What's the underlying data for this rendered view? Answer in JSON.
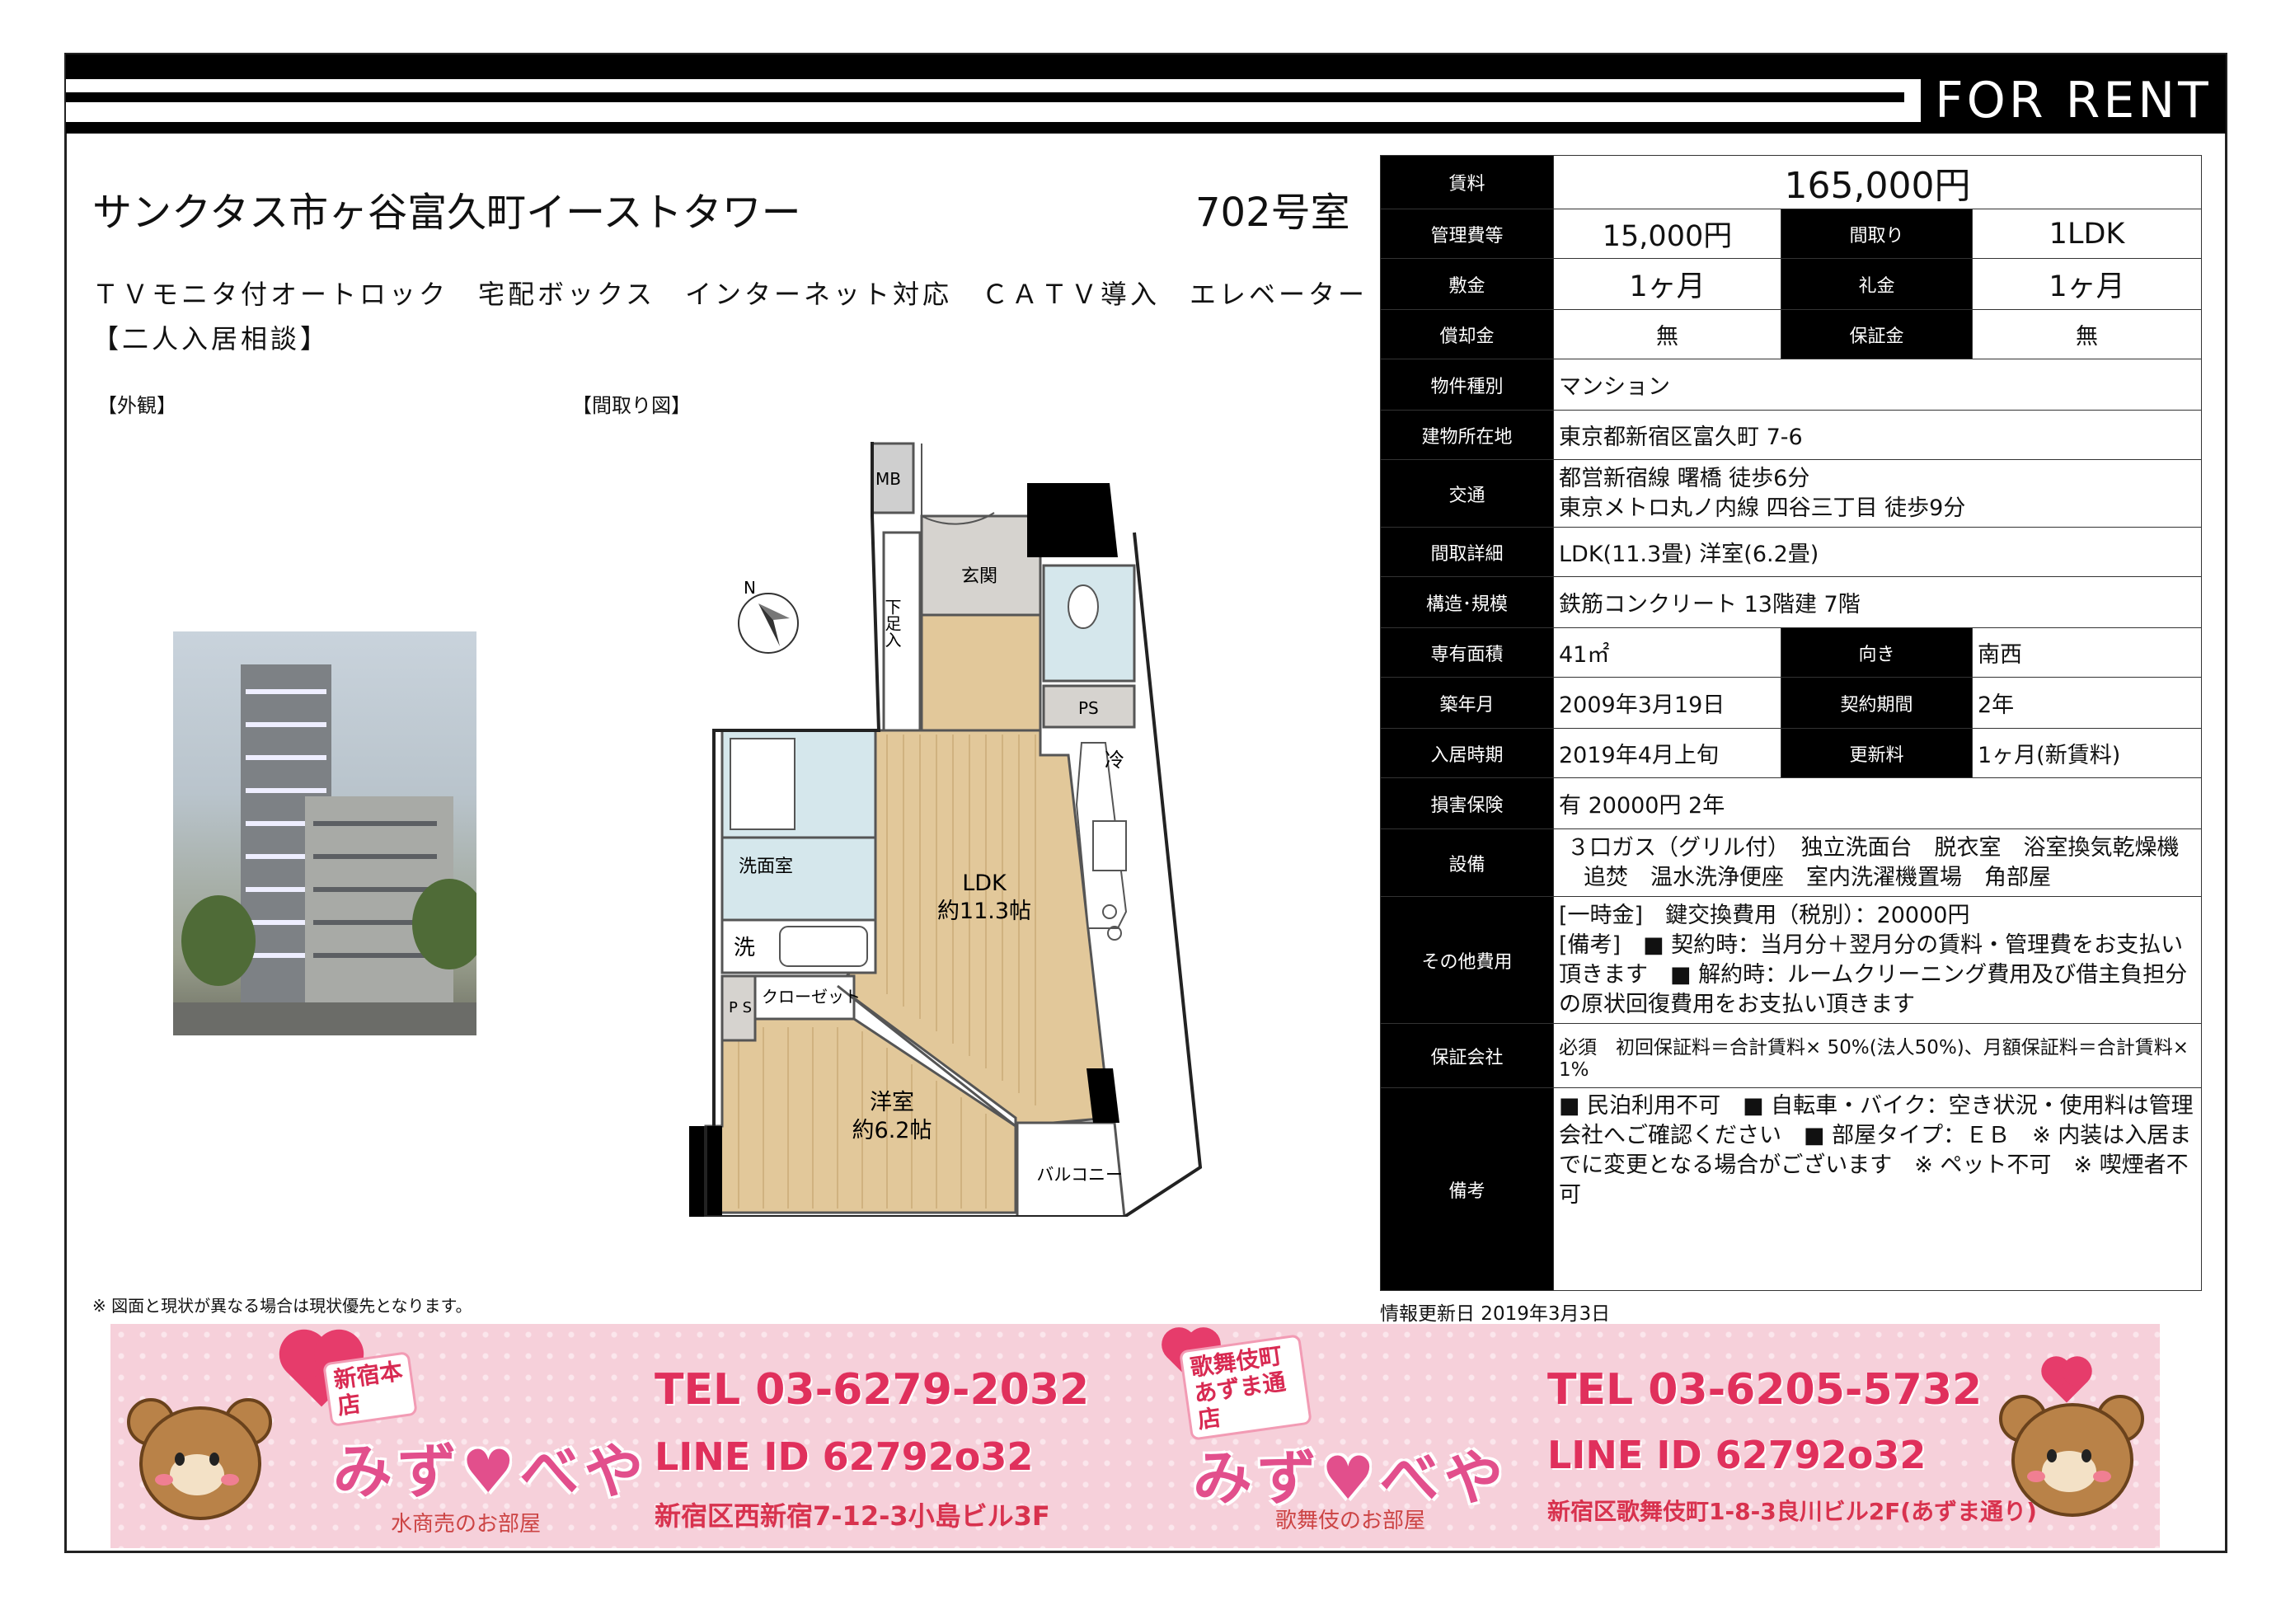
{
  "header": {
    "label": "FOR RENT"
  },
  "property": {
    "name": "サンクタス市ヶ谷富久町イーストタワー",
    "room": "702号室",
    "features_line1": "ＴＶモニタ付オートロック　宅配ボックス　インターネット対応　ＣＡＴＶ導入　エレベーター",
    "features_line2": "【二人入居相談】"
  },
  "sections": {
    "exterior": "【外観】",
    "floorplan": "【間取り図】"
  },
  "floorplan": {
    "compass": "N",
    "rooms": {
      "mb": "MB",
      "genkan": "玄関",
      "shoes": "下足入",
      "ps1": "PS",
      "fridge": "冷",
      "washroom": "洗面室",
      "washer": "洗",
      "ps2": "P S",
      "closet": "クローゼット",
      "ldk_name": "LDK",
      "ldk_size": "約11.3帖",
      "yoshitsu_name": "洋室",
      "yoshitsu_size": "約6.2帖",
      "balcony": "バルコニー"
    }
  },
  "info": {
    "rent_label": "賃料",
    "rent": "165,000円",
    "mgmt_label": "管理費等",
    "mgmt": "15,000円",
    "layout_label": "間取り",
    "layout": "1LDK",
    "deposit_label": "敷金",
    "deposit": "1ヶ月",
    "key_label": "礼金",
    "key": "1ヶ月",
    "amort_label": "償却金",
    "amort": "無",
    "guarantee_label": "保証金",
    "guarantee": "無",
    "type_label": "物件種別",
    "type": "マンション",
    "address_label": "建物所在地",
    "address": "東京都新宿区富久町 7-6",
    "transport_label": "交通",
    "transport1": "都営新宿線 曙橋 徒歩6分",
    "transport2": "東京メトロ丸ノ内線 四谷三丁目 徒歩9分",
    "detail_label": "間取詳細",
    "detail": "LDK(11.3畳) 洋室(6.2畳)",
    "structure_label": "構造･規模",
    "structure": "鉄筋コンクリート 13階建 7階",
    "area_label": "専有面積",
    "area": "41㎡",
    "direction_label": "向き",
    "direction": "南西",
    "built_label": "築年月",
    "built": "2009年3月19日",
    "term_label": "契約期間",
    "term": "2年",
    "movein_label": "入居時期",
    "movein": "2019年4月上旬",
    "renewal_label": "更新料",
    "renewal": "1ヶ月(新賃料)",
    "insurance_label": "損害保険",
    "insurance": "有  20000円 2年",
    "equipment_label": "設備",
    "equipment1": "３口ガス（グリル付）　独立洗面台　脱衣室　浴室換気乾燥機",
    "equipment2": "追焚　温水洗浄便座　室内洗濯機置場　角部屋",
    "other_label": "その他費用",
    "other1": "[一時金]　鍵交換費用（税別）：20000円",
    "other2": "[備考]　■ 契約時：当月分＋翌月分の賃料・管理費をお支払い",
    "other3": "頂きます　■ 解約時：ルームクリーニング費用及び借主負担分",
    "other4": "の原状回復費用をお支払い頂きます",
    "guarantor_label": "保証会社",
    "guarantor": "必須　初回保証料＝合計賃料× 50%(法人50%)、月額保証料＝合計賃料× 1%",
    "remarks_label": "備考",
    "remarks1": "■ 民泊利用不可　■ 自転車・バイク：空き状況・使用料は管理",
    "remarks2": "会社へご確認ください　■ 部屋タイプ：ＥＢ　※ 内装は入居ま",
    "remarks3": "でに変更となる場合がございます　※ ペット不可　※ 喫煙者不",
    "remarks4": "可"
  },
  "footer": {
    "note": "※ 図面と現状が異なる場合は現状優先となります。",
    "updated": "情報更新日 2019年3月3日"
  },
  "banner": {
    "left": {
      "tag": "新宿本店",
      "logo": "みず♥べや",
      "sub": "水商売のお部屋",
      "tel": "TEL 03-6279-2032",
      "line": "LINE ID 62792o32",
      "address": "新宿区西新宿7-12-3小島ビル3F"
    },
    "right": {
      "tag": "歌舞伎町あずま通店",
      "logo": "みず♥べや",
      "sub": "歌舞伎のお部屋",
      "tel": "TEL 03-6205-5732",
      "line": "LINE ID 62792o32",
      "address": "新宿区歌舞伎町1-8-3良川ビル2F(あずま通り)"
    }
  }
}
